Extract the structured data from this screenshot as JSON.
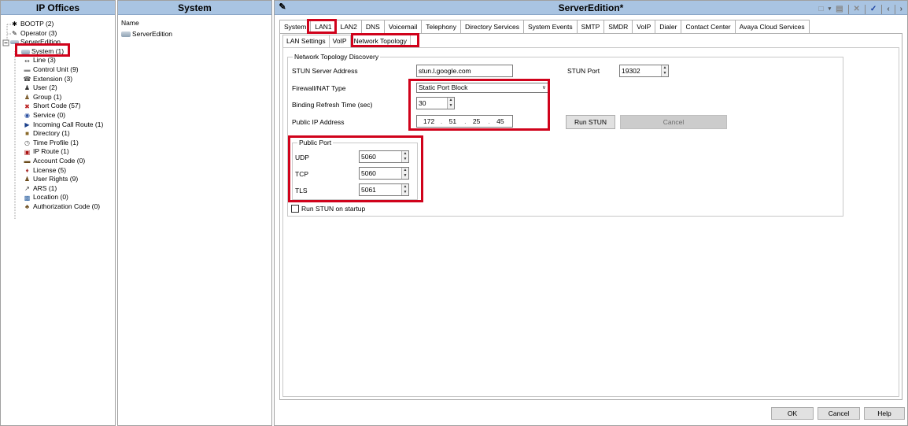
{
  "left_panel": {
    "title": "IP Offices",
    "tree": [
      {
        "label": "BOOTP (2)",
        "icon": "bootp-icon"
      },
      {
        "label": "Operator (3)",
        "icon": "operator-icon"
      },
      {
        "label": "ServerEdition",
        "icon": "server-icon"
      },
      {
        "label": "System (1)",
        "icon": "system-icon"
      },
      {
        "label": "Line (3)",
        "icon": "line-icon"
      },
      {
        "label": "Control Unit (9)",
        "icon": "control-unit-icon"
      },
      {
        "label": "Extension (3)",
        "icon": "extension-icon"
      },
      {
        "label": "User (2)",
        "icon": "user-icon"
      },
      {
        "label": "Group (1)",
        "icon": "group-icon"
      },
      {
        "label": "Short Code (57)",
        "icon": "short-code-icon"
      },
      {
        "label": "Service (0)",
        "icon": "service-icon"
      },
      {
        "label": "Incoming Call Route (1)",
        "icon": "incoming-call-route-icon"
      },
      {
        "label": "Directory (1)",
        "icon": "directory-icon"
      },
      {
        "label": "Time Profile (1)",
        "icon": "time-profile-icon"
      },
      {
        "label": "IP Route (1)",
        "icon": "ip-route-icon"
      },
      {
        "label": "Account Code (0)",
        "icon": "account-code-icon"
      },
      {
        "label": "License (5)",
        "icon": "license-icon"
      },
      {
        "label": "User Rights (9)",
        "icon": "user-rights-icon"
      },
      {
        "label": "ARS (1)",
        "icon": "ars-icon"
      },
      {
        "label": "Location (0)",
        "icon": "location-icon"
      },
      {
        "label": "Authorization Code (0)",
        "icon": "authorization-code-icon"
      }
    ]
  },
  "middle_panel": {
    "title": "System",
    "column_header": "Name",
    "rows": [
      "ServerEdition"
    ]
  },
  "right_panel": {
    "title": "ServerEdition*",
    "tabs": [
      "System",
      "LAN1",
      "LAN2",
      "DNS",
      "Voicemail",
      "Telephony",
      "Directory Services",
      "System Events",
      "SMTP",
      "SMDR",
      "VoIP",
      "Dialer",
      "Contact Center",
      "Avaya Cloud Services"
    ],
    "subtabs": [
      "LAN Settings",
      "VoIP",
      "Network Topology"
    ],
    "group_title": "Network Topology Discovery",
    "stun_server_label": "STUN Server Address",
    "stun_server_value": "stun.l.google.com",
    "stun_port_label": "STUN Port",
    "stun_port_value": "19302",
    "firewall_label": "Firewall/NAT Type",
    "firewall_value": "Static Port Block",
    "binding_label": "Binding Refresh Time (sec)",
    "binding_value": "30",
    "public_ip_label": "Public IP Address",
    "public_ip": [
      "172",
      "51",
      "25",
      "45"
    ],
    "run_stun_label": "Run STUN",
    "cancel_stun_label": "Cancel",
    "public_port_title": "Public Port",
    "udp_label": "UDP",
    "udp_value": "5060",
    "tcp_label": "TCP",
    "tcp_value": "5060",
    "tls_label": "TLS",
    "tls_value": "5061",
    "run_on_startup_label": "Run STUN on startup",
    "ok_label": "OK",
    "cancel_label": "Cancel",
    "help_label": "Help"
  },
  "colors": {
    "header_bg": "#a9c4e2",
    "highlight": "#d0021b"
  }
}
